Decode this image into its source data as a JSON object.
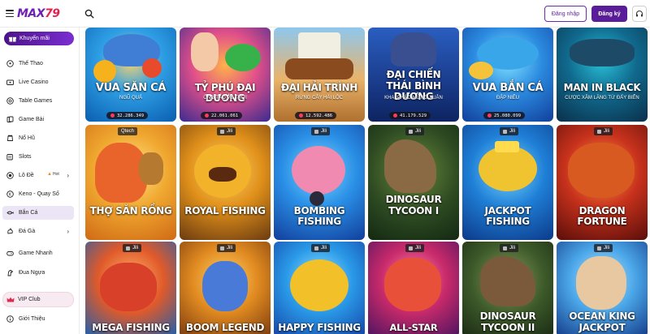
{
  "header": {
    "logo_main": "MAX",
    "logo_num": "79",
    "login_label": "Đăng nhập",
    "register_label": "Đăng ký"
  },
  "sidebar": {
    "promo_label": "Khuyến mãi",
    "items": [
      {
        "label": "Thể Thao"
      },
      {
        "label": "Live Casino"
      },
      {
        "label": "Table Games"
      },
      {
        "label": "Game Bài"
      },
      {
        "label": "Nổ Hũ"
      },
      {
        "label": "Slots"
      },
      {
        "label": "Lô Đề"
      },
      {
        "label": "Keno - Quay Số"
      },
      {
        "label": "Bắn Cá"
      },
      {
        "label": "Đá Gà"
      },
      {
        "label": "Game Nhanh"
      },
      {
        "label": "Đua Ngựa"
      }
    ],
    "hot_label": "Hot",
    "vip_label": "VIP Club",
    "about_label": "Giới Thiệu"
  },
  "games_row1": [
    {
      "title": "VUA SĂN CÁ",
      "subtitle": "NGŨ QUẢ",
      "jackpot": "32.286.349"
    },
    {
      "title": "TỶ PHÚ ĐẠI DƯƠNG",
      "subtitle": "ÔNG TÁO VỀ TRỜI",
      "jackpot": "22.061.061"
    },
    {
      "title": "ĐẠI HẢI TRÌNH",
      "subtitle": "RỪNG CÂY HÁI LỘC",
      "jackpot": "12.592.486"
    },
    {
      "title_line1": "ĐẠI CHIẾN",
      "title_line2": "THÁI BÌNH DƯƠNG",
      "subtitle": "KHAI PHÁO MỪNG XUÂN",
      "jackpot": "41.179.529"
    },
    {
      "title": "VUA BẮN CÁ",
      "subtitle": "ĐẬP NIÊU",
      "jackpot": "25.080.099"
    },
    {
      "title": "MAN IN BLACK",
      "subtitle": "CƯỢC XÂM LĂNG TỪ ĐẤY BIỂN"
    }
  ],
  "games_row2": [
    {
      "title": "THỢ SĂN RỒNG",
      "provider": "Qtech"
    },
    {
      "title": "ROYAL FISHING",
      "provider": "Jili"
    },
    {
      "title": "BOMBING FISHING",
      "provider": "Jili"
    },
    {
      "title_line1": "DINOSAUR",
      "title_line2": "TYCOON I",
      "provider": "Jili"
    },
    {
      "title": "JACKPOT FISHING",
      "provider": "Jili"
    },
    {
      "title": "DRAGON FORTUNE",
      "provider": "Jili"
    }
  ],
  "games_row3": [
    {
      "title": "MEGA FISHING",
      "provider": "Jili"
    },
    {
      "title": "BOOM LEGEND",
      "provider": "Jili"
    },
    {
      "title": "HAPPY FISHING",
      "provider": "Jili"
    },
    {
      "title": "ALL-STAR FISHING",
      "provider": "Jili"
    },
    {
      "title_line1": "DINOSAUR",
      "title_line2": "TYCOON II",
      "provider": "Jili"
    },
    {
      "title_line1": "OCEAN KING",
      "title_line2": "JACKPOT",
      "provider": "Jili"
    }
  ],
  "colors": {
    "brand_purple": "#5a1d99",
    "brand_red": "#e5224f"
  }
}
